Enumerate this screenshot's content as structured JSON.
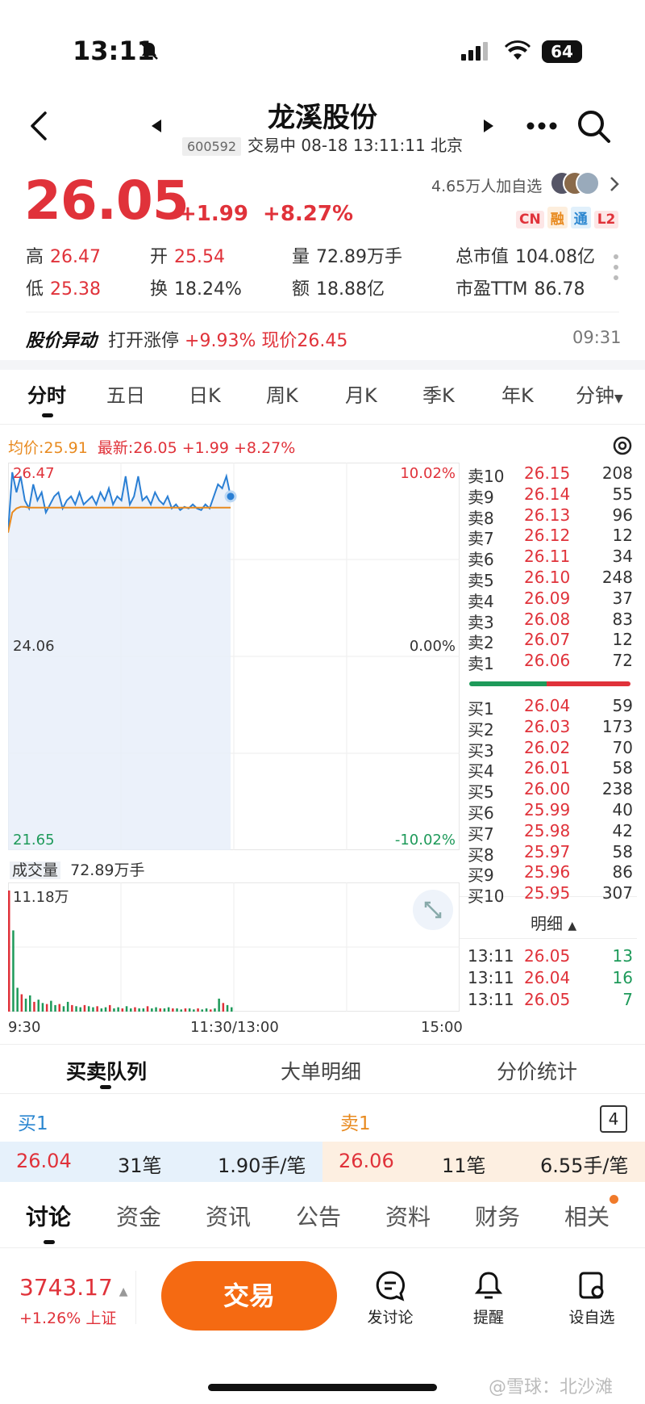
{
  "status_bar": {
    "time": "13:11",
    "battery": "64"
  },
  "header": {
    "title": "龙溪股份",
    "code": "600592",
    "status": "交易中 08-18 13:11:11 北京",
    "followers": "4.65万人加自选",
    "tags": [
      "CN",
      "融",
      "通",
      "L2"
    ]
  },
  "quote": {
    "price": "26.05",
    "change": "+1.99",
    "change_pct": "+8.27%",
    "stats": [
      {
        "label": "高",
        "value": "26.47"
      },
      {
        "label": "开",
        "value": "25.54"
      },
      {
        "label": "量",
        "value": "72.89万手"
      },
      {
        "label": "总市值",
        "value": "104.08亿"
      },
      {
        "label": "低",
        "value": "25.38"
      },
      {
        "label": "换",
        "value": "18.24%"
      },
      {
        "label": "额",
        "value": "18.88亿"
      },
      {
        "label": "市盈TTM",
        "value": "86.78"
      }
    ]
  },
  "alert": {
    "title": "股价异动",
    "prefix": "打开涨停",
    "pct": "+9.93%",
    "price": "现价26.45",
    "time": "09:31"
  },
  "chart_tabs": [
    "分时",
    "五日",
    "日K",
    "周K",
    "月K",
    "季K",
    "年K",
    "分钟"
  ],
  "intraday": {
    "avg_label": "均价:25.91",
    "latest_label": "最新:26.05",
    "latest_change": "+1.99",
    "latest_pct": "+8.27%",
    "y_top": "26.47",
    "y_mid": "24.06",
    "y_bot": "21.65",
    "pct_top": "10.02%",
    "pct_mid": "0.00%",
    "pct_bot": "-10.02%",
    "volume_label": "成交量",
    "volume_value": "72.89万手",
    "volume_max": "11.18万",
    "x_labels": [
      "9:30",
      "11:30/13:00",
      "15:00"
    ]
  },
  "chart_data": {
    "type": "line",
    "ylim": [
      21.65,
      26.47
    ],
    "price": [
      25.6,
      26.35,
      26.1,
      26.3,
      26.0,
      25.9,
      26.2,
      26.0,
      26.1,
      25.85,
      25.95,
      26.05,
      26.1,
      25.9,
      26.0,
      26.05,
      25.95,
      26.1,
      25.95,
      26.0,
      26.05,
      25.95,
      26.1,
      26.0,
      26.15,
      25.95,
      26.05,
      26.0,
      26.3,
      25.95,
      26.05,
      26.3,
      26.0,
      26.05,
      25.95,
      26.1,
      26.0,
      25.95,
      26.05,
      25.9,
      25.95,
      25.88,
      25.92,
      25.9,
      25.95,
      25.9,
      25.88,
      25.95,
      25.9,
      26.05,
      26.2,
      26.15,
      26.3,
      26.05
    ],
    "avg": [
      25.6,
      25.85,
      25.9,
      25.92,
      25.92,
      25.91,
      25.91,
      25.91,
      25.91,
      25.91,
      25.91,
      25.91,
      25.91,
      25.91,
      25.91,
      25.91,
      25.91,
      25.91,
      25.91,
      25.91,
      25.91,
      25.91,
      25.91,
      25.91,
      25.91,
      25.91,
      25.91,
      25.91,
      25.91,
      25.91,
      25.91,
      25.91,
      25.91,
      25.91,
      25.91,
      25.91,
      25.91,
      25.91,
      25.91,
      25.91,
      25.91,
      25.91,
      25.91,
      25.91,
      25.91,
      25.91,
      25.91,
      25.91,
      25.91,
      25.91,
      25.91,
      25.91,
      25.91,
      25.91
    ],
    "volume": [
      11.18,
      7.5,
      2.2,
      1.6,
      1.2,
      1.5,
      0.9,
      1.1,
      0.8,
      0.7,
      1.0,
      0.6,
      0.7,
      0.5,
      0.9,
      0.6,
      0.5,
      0.4,
      0.6,
      0.5,
      0.4,
      0.5,
      0.3,
      0.4,
      0.6,
      0.3,
      0.4,
      0.3,
      0.5,
      0.3,
      0.4,
      0.3,
      0.3,
      0.5,
      0.3,
      0.4,
      0.3,
      0.3,
      0.4,
      0.3,
      0.3,
      0.2,
      0.3,
      0.3,
      0.2,
      0.3,
      0.2,
      0.3,
      0.2,
      0.3,
      1.2,
      0.8,
      0.6,
      0.4
    ],
    "vol_max": 11.18
  },
  "order_book": {
    "asks": [
      {
        "label": "卖10",
        "price": "26.15",
        "qty": "208"
      },
      {
        "label": "卖9",
        "price": "26.14",
        "qty": "55"
      },
      {
        "label": "卖8",
        "price": "26.13",
        "qty": "96"
      },
      {
        "label": "卖7",
        "price": "26.12",
        "qty": "12"
      },
      {
        "label": "卖6",
        "price": "26.11",
        "qty": "34"
      },
      {
        "label": "卖5",
        "price": "26.10",
        "qty": "248"
      },
      {
        "label": "卖4",
        "price": "26.09",
        "qty": "37"
      },
      {
        "label": "卖3",
        "price": "26.08",
        "qty": "83"
      },
      {
        "label": "卖2",
        "price": "26.07",
        "qty": "12"
      },
      {
        "label": "卖1",
        "price": "26.06",
        "qty": "72"
      }
    ],
    "bids": [
      {
        "label": "买1",
        "price": "26.04",
        "qty": "59"
      },
      {
        "label": "买2",
        "price": "26.03",
        "qty": "173"
      },
      {
        "label": "买3",
        "price": "26.02",
        "qty": "70"
      },
      {
        "label": "买4",
        "price": "26.01",
        "qty": "58"
      },
      {
        "label": "买5",
        "price": "26.00",
        "qty": "238"
      },
      {
        "label": "买6",
        "price": "25.99",
        "qty": "40"
      },
      {
        "label": "买7",
        "price": "25.98",
        "qty": "42"
      },
      {
        "label": "买8",
        "price": "25.97",
        "qty": "58"
      },
      {
        "label": "买9",
        "price": "25.96",
        "qty": "86"
      },
      {
        "label": "买10",
        "price": "25.95",
        "qty": "307"
      }
    ],
    "detail_label": "明细",
    "ticks": [
      {
        "time": "13:11",
        "price": "26.05",
        "qty": "13"
      },
      {
        "time": "13:11",
        "price": "26.04",
        "qty": "16"
      },
      {
        "time": "13:11",
        "price": "26.05",
        "qty": "7"
      }
    ]
  },
  "queue_tabs": [
    "买卖队列",
    "大单明细",
    "分价统计"
  ],
  "queue": {
    "buy_label": "买1",
    "sell_label": "卖1",
    "count_badge": "4",
    "buy": {
      "price": "26.04",
      "orders": "31笔",
      "avg": "1.90手/笔"
    },
    "sell": {
      "price": "26.06",
      "orders": "11笔",
      "avg": "6.55手/笔"
    }
  },
  "bottom_tabs": [
    "讨论",
    "资金",
    "资讯",
    "公告",
    "资料",
    "财务",
    "相关"
  ],
  "toolbar": {
    "index_value": "3743.17",
    "index_change": "+1.26%",
    "index_name": "上证",
    "trade": "交易",
    "discuss": "发讨论",
    "remind": "提醒",
    "watch": "设自选"
  },
  "watermark": "@雪球：北沙滩"
}
